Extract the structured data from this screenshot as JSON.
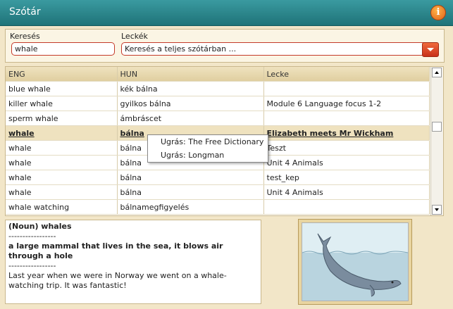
{
  "window": {
    "title": "Szótár",
    "info_icon": "info-icon"
  },
  "search": {
    "label": "Keresés",
    "value": "whale"
  },
  "lessons": {
    "label": "Leckék",
    "selected": "Keresés a teljes szótárban ..."
  },
  "table": {
    "columns": [
      "ENG",
      "HUN",
      "Lecke"
    ],
    "rows": [
      [
        "blue whale",
        "kék bálna",
        ""
      ],
      [
        "killer whale",
        "gyilkos bálna",
        "Module 6 Language focus 1-2"
      ],
      [
        "sperm whale",
        "ámbráscet",
        ""
      ],
      [
        "whale",
        "bálna",
        "Elizabeth meets Mr Wickham"
      ],
      [
        "whale",
        "bálna",
        "Teszt"
      ],
      [
        "whale",
        "bálna",
        "Unit 4 Animals"
      ],
      [
        "whale",
        "bálna",
        "test_kep"
      ],
      [
        "whale",
        "bálna",
        "Unit 4 Animals"
      ],
      [
        "whale watching",
        "bálnamegfigyelés",
        ""
      ]
    ],
    "selected_row": 3
  },
  "context_menu": {
    "items": [
      "Ugrás: The Free Dictionary",
      "Ugrás: Longman"
    ]
  },
  "definition": {
    "heading": "(Noun) whales",
    "sep1": "-----------------",
    "meaning": "a large mammal that lives in the sea, it blows air through a hole",
    "sep2": "-----------------",
    "example": "Last year when we were in Norway we went on a whale-watching trip. It was fantastic!"
  },
  "colors": {
    "titlebar": "#2a8a90",
    "accent": "#c43a2a",
    "panel": "#f2e6c8"
  }
}
